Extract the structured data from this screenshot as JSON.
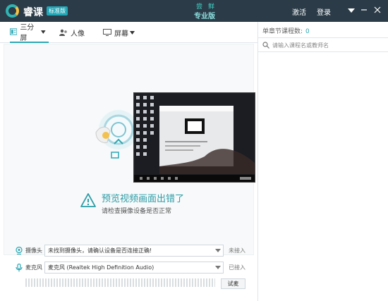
{
  "app": {
    "brand": "睿课",
    "edition_badge": "标准版",
    "trial_text": "尝鲜",
    "pro_label": "专业版",
    "activate": "激活",
    "login": "登录"
  },
  "tabs": [
    {
      "label": "三分屏",
      "icon": "three-split-icon",
      "active": true
    },
    {
      "label": "人像",
      "icon": "portrait-icon",
      "active": false
    },
    {
      "label": "屏幕",
      "icon": "monitor-icon",
      "active": false
    }
  ],
  "preview": {
    "error_title": "预览视频画面出错了",
    "error_subtitle": "请检查摄像设备是否正常"
  },
  "devices": {
    "camera": {
      "label": "摄像头",
      "value": "未找到摄像头，请确认设备是否连接正确!",
      "status": "未接入"
    },
    "mic": {
      "label": "麦克风",
      "value": "麦克风 (Realtek High Definition Audio)",
      "status": "已接入"
    },
    "test_button": "试麦"
  },
  "right_panel": {
    "count_label": "单章节课程数:",
    "count_value": "0",
    "search_placeholder": "请输入课程名或教师名"
  },
  "colors": {
    "titlebar": "#2b3b48",
    "accent": "#2aa7b4"
  }
}
